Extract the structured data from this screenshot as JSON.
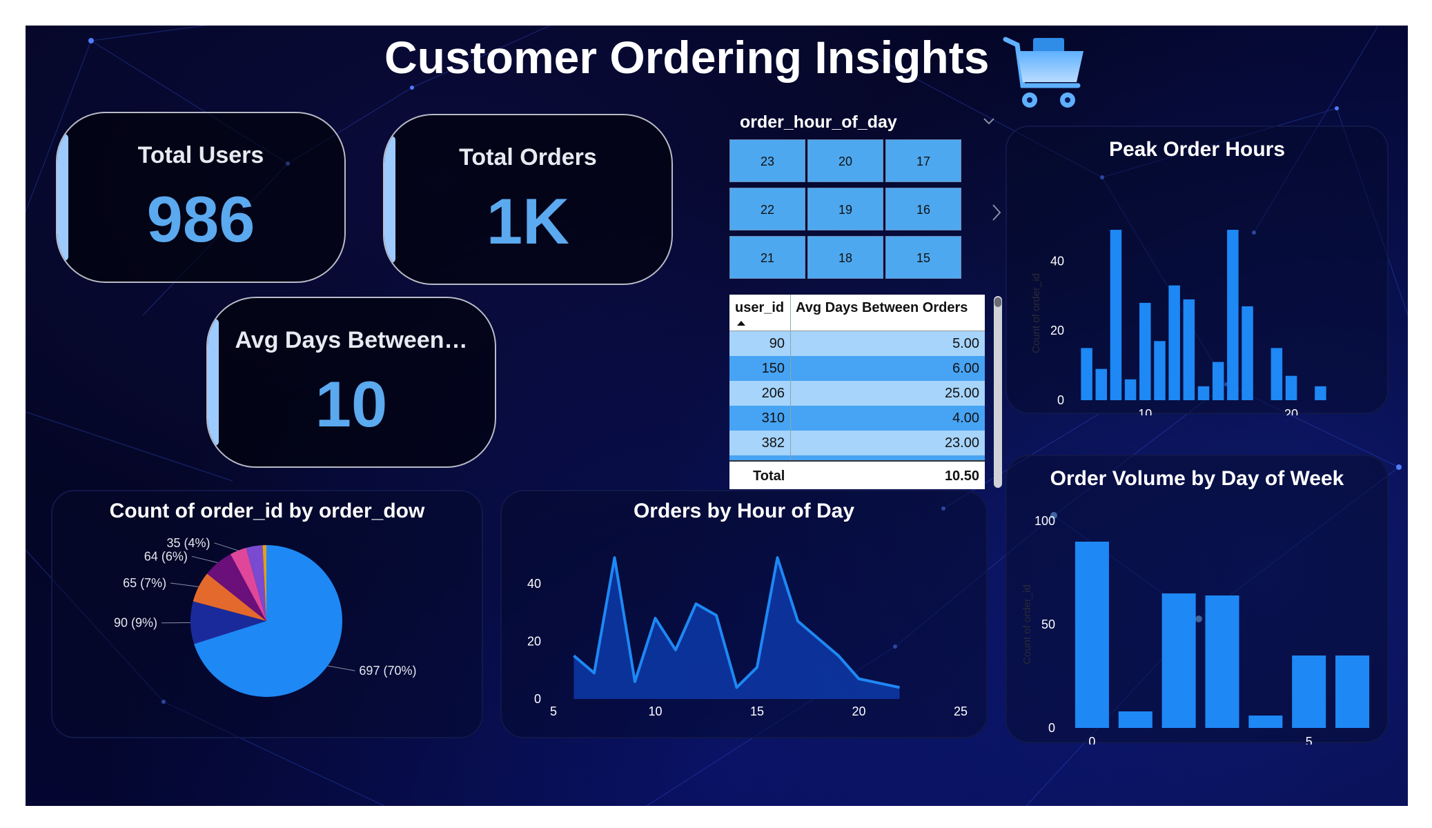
{
  "title": "Customer Ordering Insights",
  "kpis": [
    {
      "label": "Total Users",
      "value": "986"
    },
    {
      "label": "Total Orders",
      "value": "1K"
    },
    {
      "label": "Avg Days Between…",
      "value": "10"
    }
  ],
  "slicer": {
    "title": "order_hour_of_day",
    "tiles": [
      "23",
      "20",
      "17",
      "22",
      "19",
      "16",
      "21",
      "18",
      "15"
    ]
  },
  "table": {
    "headers": [
      "user_id",
      "Avg Days Between Orders"
    ],
    "rows": [
      {
        "user_id": "90",
        "avg": "5.00"
      },
      {
        "user_id": "150",
        "avg": "6.00"
      },
      {
        "user_id": "206",
        "avg": "25.00"
      },
      {
        "user_id": "310",
        "avg": "4.00"
      },
      {
        "user_id": "382",
        "avg": "23.00"
      }
    ],
    "total_label": "Total",
    "total_value": "10.50"
  },
  "colors": {
    "accent": "#1e88f5",
    "kpi_value": "#5ba9ef",
    "row_light": "#a6d4fb",
    "row_dark": "#47a3f3"
  },
  "chart_data": [
    {
      "id": "peak",
      "type": "bar",
      "title": "Peak Order Hours",
      "ylabel": "Count of order_id",
      "x": [
        6,
        7,
        8,
        9,
        10,
        11,
        12,
        13,
        14,
        15,
        16,
        17,
        18,
        19,
        20,
        21,
        22
      ],
      "values": [
        15,
        9,
        49,
        6,
        28,
        17,
        33,
        29,
        4,
        11,
        49,
        27,
        0,
        15,
        7,
        0,
        4
      ],
      "xticks": [
        10,
        20
      ],
      "yticks": [
        0,
        20,
        40
      ],
      "ylim": [
        0,
        50
      ]
    },
    {
      "id": "dow",
      "type": "bar",
      "title": "Order Volume by Day of Week",
      "ylabel": "Count of order_id",
      "x": [
        0,
        1,
        2,
        3,
        4,
        5,
        6
      ],
      "values": [
        90,
        8,
        65,
        64,
        6,
        35,
        35
      ],
      "xticks": [
        0,
        5
      ],
      "yticks": [
        0,
        50,
        100
      ],
      "ylim": [
        0,
        100
      ]
    },
    {
      "id": "pie",
      "type": "pie",
      "title": "Count of order_id by order_dow",
      "slices": [
        {
          "value": 697,
          "label": "697 (70%)",
          "color": "#1e88f5"
        },
        {
          "value": 90,
          "label": "90 (9%)",
          "color": "#1a2a9a"
        },
        {
          "value": 65,
          "label": "65 (7%)",
          "color": "#e36a2c"
        },
        {
          "value": 64,
          "label": "64 (6%)",
          "color": "#6b0f7a"
        },
        {
          "value": 35,
          "label": "35 (4%)",
          "color": "#e0479a"
        },
        {
          "value": 35,
          "label": "",
          "color": "#7a4bd0"
        },
        {
          "value": 8,
          "label": "",
          "color": "#e0a020"
        }
      ]
    },
    {
      "id": "area",
      "type": "area",
      "title": "Orders by Hour of Day",
      "x": [
        6,
        7,
        8,
        9,
        10,
        11,
        12,
        13,
        14,
        15,
        16,
        17,
        18,
        19,
        20,
        22
      ],
      "y": [
        15,
        9,
        49,
        6,
        28,
        17,
        33,
        29,
        4,
        11,
        49,
        27,
        21,
        15,
        7,
        4
      ],
      "xticks": [
        5,
        10,
        15,
        20,
        25
      ],
      "yticks": [
        0,
        20,
        40
      ],
      "xlim": [
        5,
        25
      ],
      "ylim": [
        0,
        50
      ]
    }
  ]
}
